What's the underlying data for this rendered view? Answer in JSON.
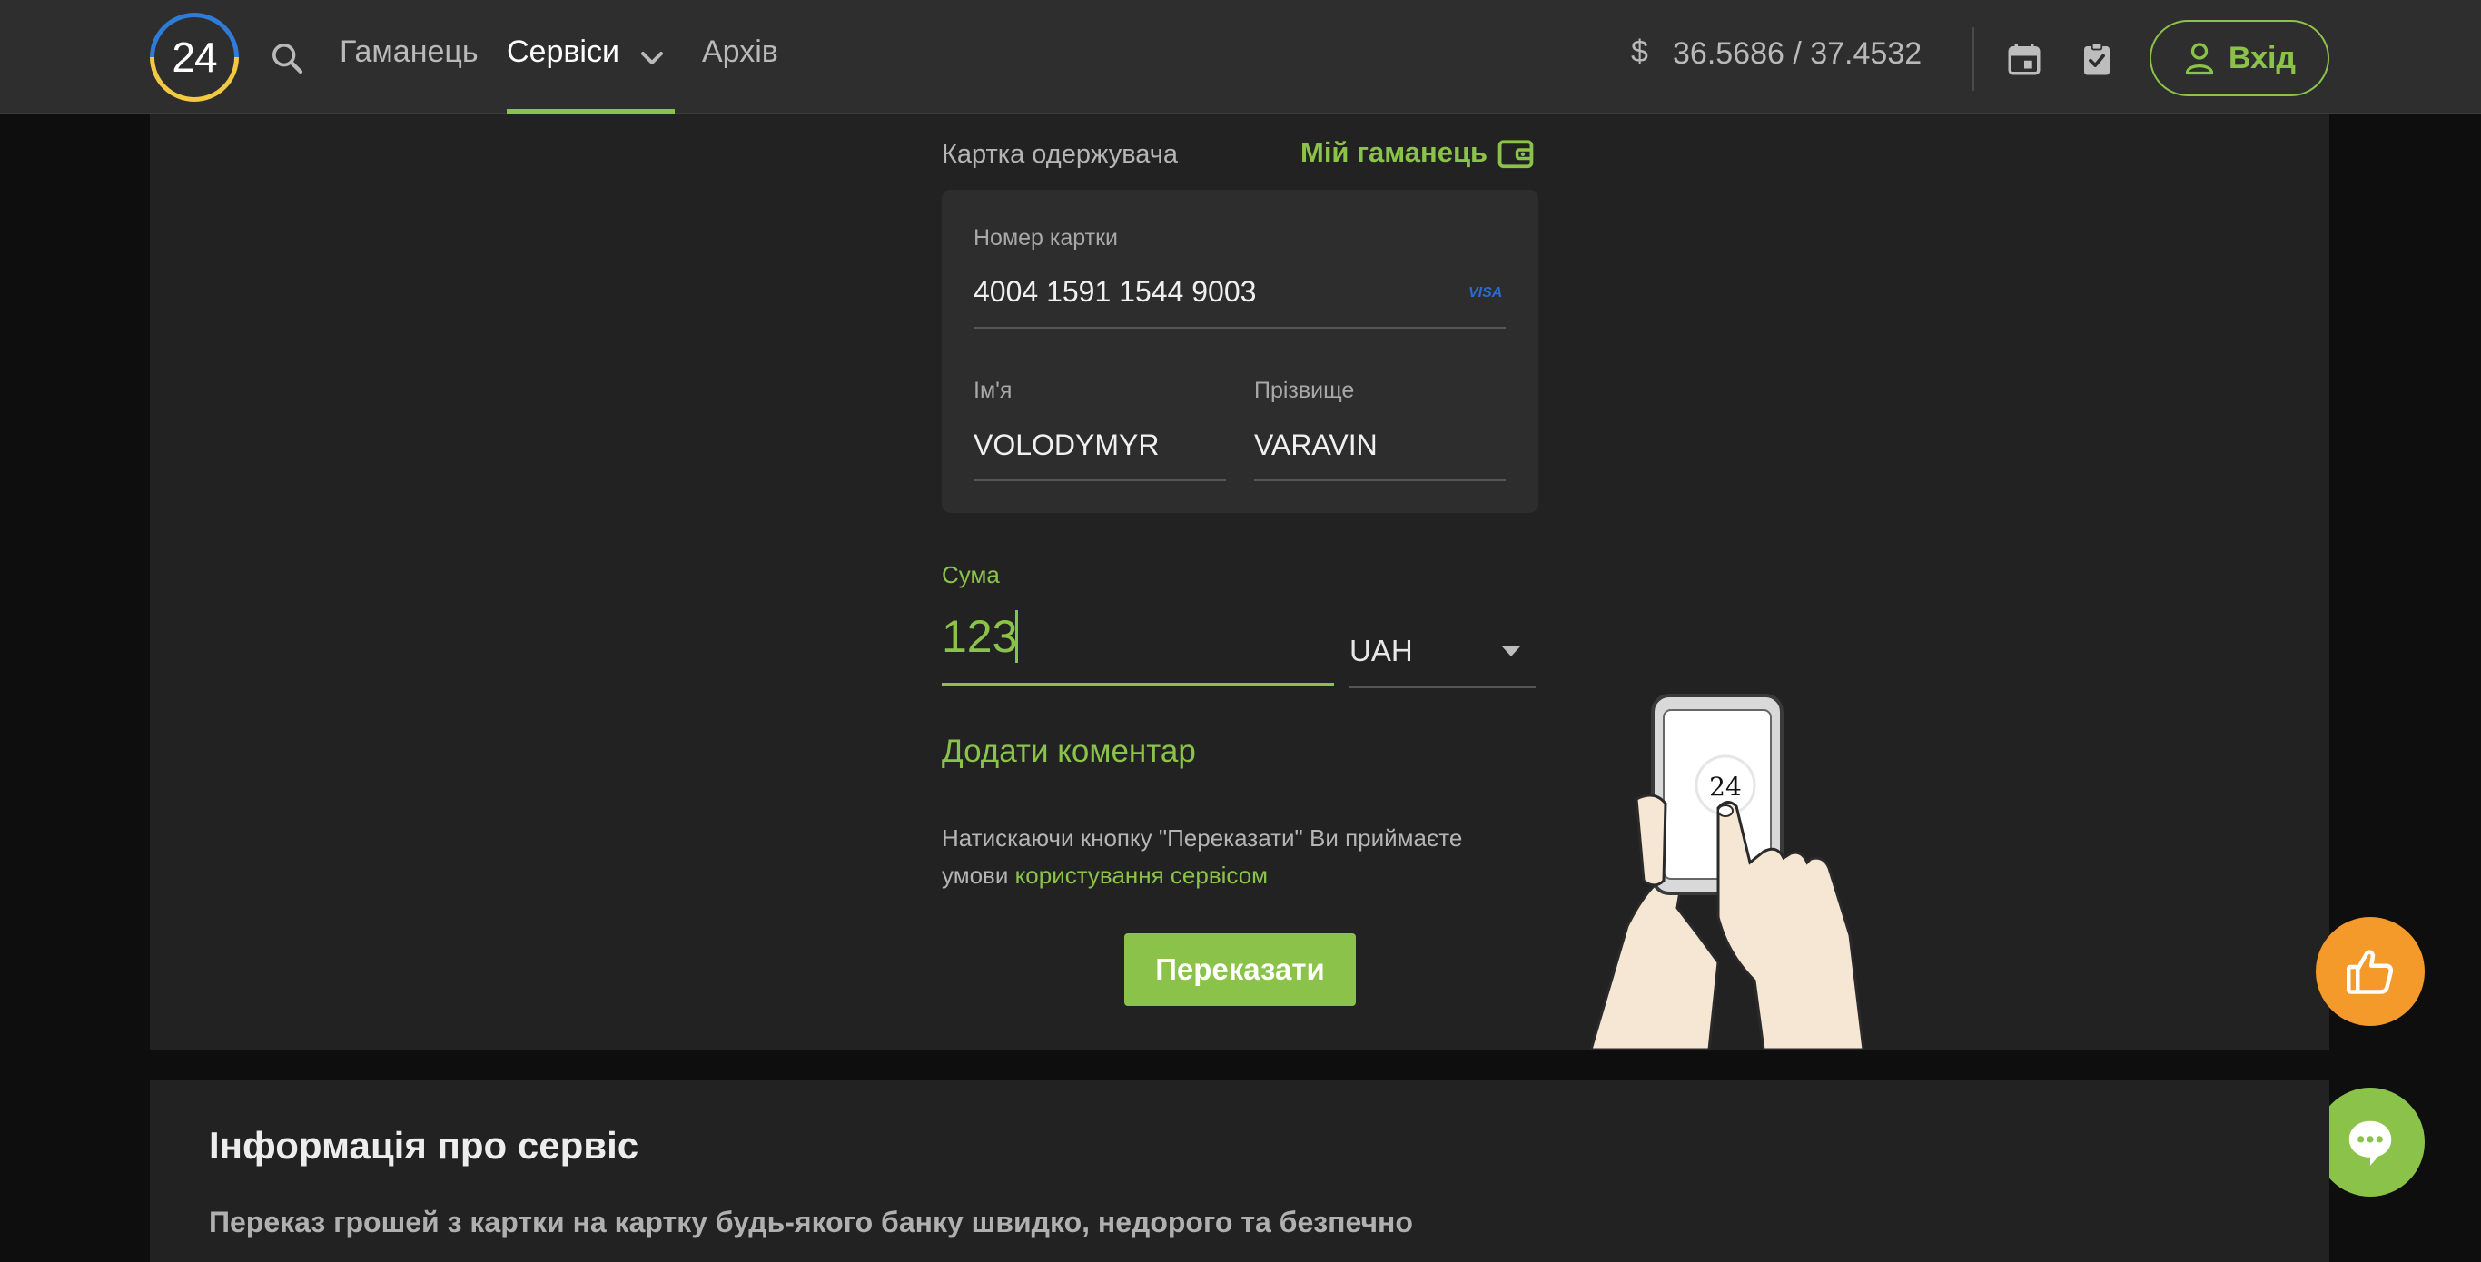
{
  "header": {
    "logo_text": "24",
    "nav": {
      "wallet": "Гаманець",
      "services": "Сервіси",
      "archive": "Архів"
    },
    "rate_symbol": "$",
    "rate": "36.5686 / 37.4532",
    "login_label": "Вхід"
  },
  "form": {
    "recipient_label": "Картка одержувача",
    "my_wallet_label": "Мій гаманець",
    "card_number_label": "Номер картки",
    "card_number_value": "4004 1591 1544 9003",
    "card_brand": "VISA",
    "first_name_label": "Ім'я",
    "first_name_value": "VOLODYMYR",
    "last_name_label": "Прізвище",
    "last_name_value": "VARAVIN",
    "amount_label": "Сума",
    "amount_value": "123",
    "currency_value": "UAH",
    "add_comment_label": "Додати коментар",
    "terms_text": "Натискаючи кнопку \"Переказати\" Ви приймаєте умови ",
    "terms_link": "користування сервісом",
    "submit_label": "Переказати"
  },
  "illustration": {
    "phone_label": "24"
  },
  "info": {
    "title": "Інформація про сервіс",
    "text": "Переказ грошей з картки на картку будь-якого банку швидко, недорого та безпечно"
  },
  "colors": {
    "accent": "#8bc34a",
    "like_fab": "#f39a2b",
    "logo_blue": "#2f7bd8",
    "logo_yellow": "#f3c842"
  },
  "icons": [
    "search-icon",
    "chevron-down-icon",
    "calendar-icon",
    "clipboard-check-icon",
    "user-icon",
    "wallet-icon",
    "thumbs-up-icon",
    "chat-icon"
  ]
}
